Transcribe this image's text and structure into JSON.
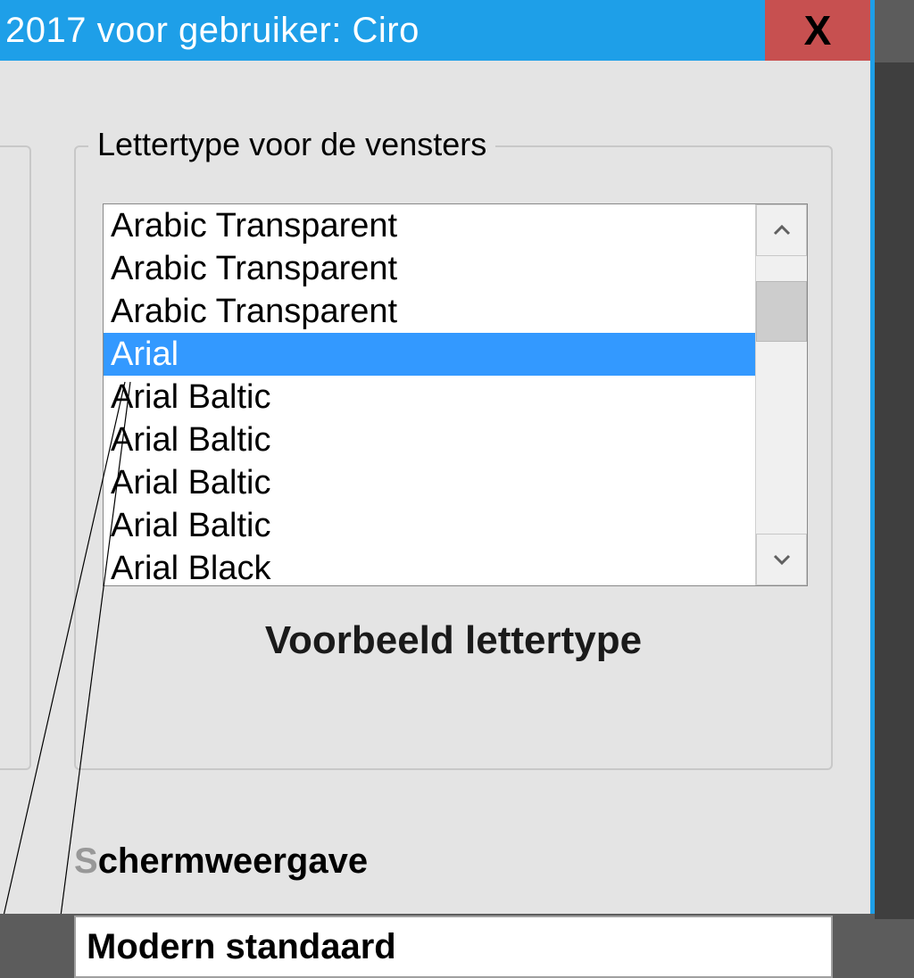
{
  "window": {
    "title": "2017 voor gebruiker: Ciro"
  },
  "fontGroup": {
    "legend": "Lettertype voor de vensters",
    "items": [
      "Arabic Transparent",
      "Arabic Transparent",
      "Arabic Transparent",
      "Arial",
      "Arial Baltic",
      "Arial Baltic",
      "Arial Baltic",
      "Arial Baltic",
      "Arial Black"
    ],
    "selectedIndex": 3,
    "previewLabel": "Voorbeeld lettertype"
  },
  "sectionDisplay": {
    "label_grey": "S",
    "label_rest": "chermweergave",
    "dropdownValue": "Modern  standaard"
  }
}
